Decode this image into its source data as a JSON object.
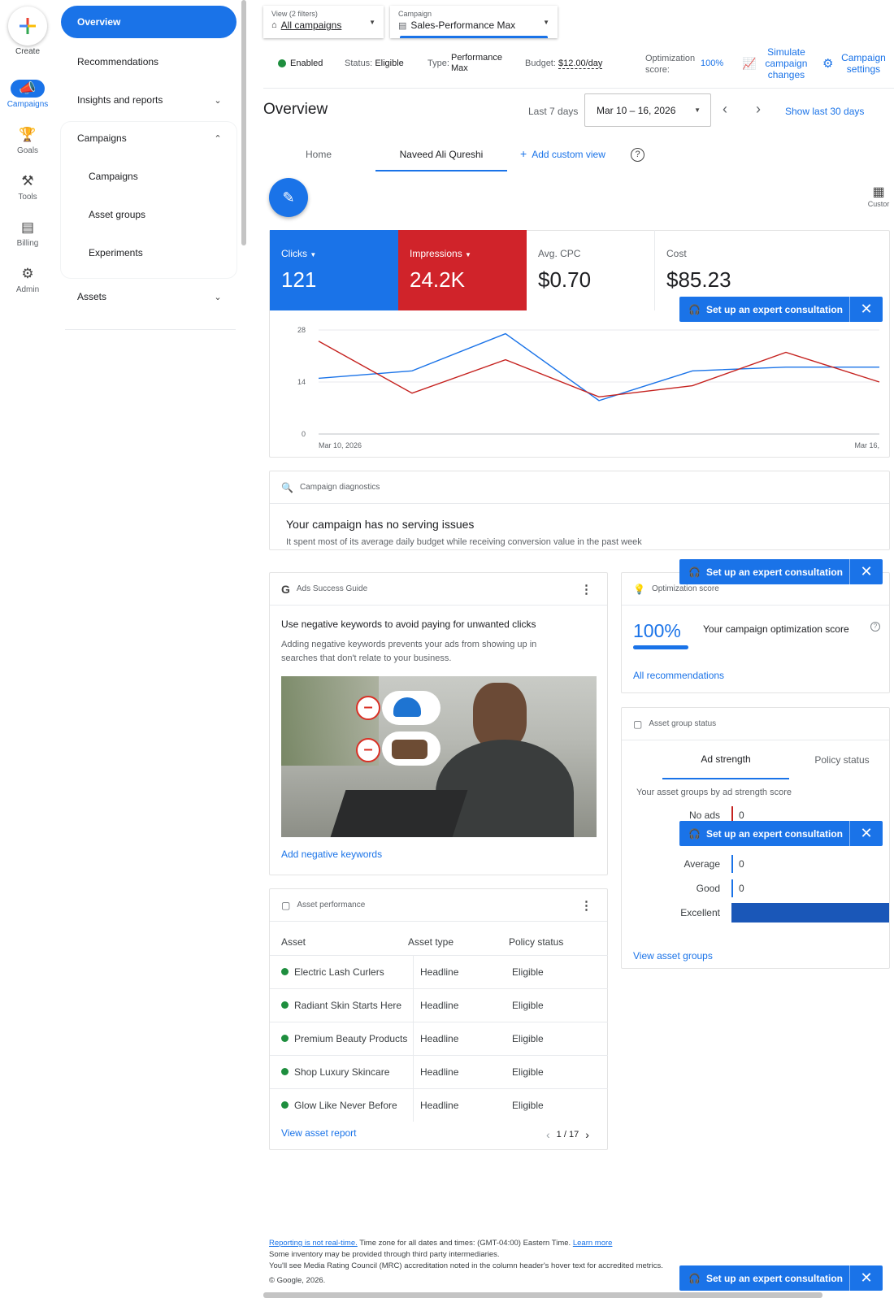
{
  "rail": {
    "create": "Create",
    "campaigns": "Campaigns",
    "goals": "Goals",
    "tools": "Tools",
    "billing": "Billing",
    "admin": "Admin"
  },
  "nav": {
    "overview": "Overview",
    "recommendations": "Recommendations",
    "insights": "Insights and reports",
    "campaigns_section": "Campaigns",
    "campaigns": "Campaigns",
    "asset_groups": "Asset groups",
    "experiments": "Experiments",
    "assets": "Assets"
  },
  "filters": {
    "view_label": "View (2 filters)",
    "view_value": "All campaigns",
    "campaign_label": "Campaign",
    "campaign_value": "Sales-Performance Max"
  },
  "status_bar": {
    "enabled": "Enabled",
    "status_label": "Status:",
    "status_value": "Eligible",
    "type_label": "Type:",
    "type_value": "Performance Max",
    "budget_label": "Budget:",
    "budget_value": "$12.00/day",
    "opt_label": "Optimization score:",
    "opt_value": "100%",
    "simulate": "Simulate campaign changes",
    "settings": "Campaign settings"
  },
  "page": {
    "title": "Overview",
    "range_label": "Last 7 days",
    "date_range": "Mar 10 – 16, 2026",
    "show_last": "Show last 30 days"
  },
  "tabs": {
    "home": "Home",
    "user": "Naveed Ali Qureshi",
    "add_view": "Add custom view"
  },
  "customize": "Custor",
  "metrics": {
    "clicks_label": "Clicks",
    "clicks_value": "121",
    "impressions_label": "Impressions",
    "impressions_value": "24.2K",
    "cpc_label": "Avg. CPC",
    "cpc_value": "$0.70",
    "cost_label": "Cost",
    "cost_value": "$85.23"
  },
  "toast": {
    "label": "Set up an expert consultation"
  },
  "chart_data": {
    "type": "line",
    "x": [
      "Mar 10, 2026",
      "Mar 11",
      "Mar 12",
      "Mar 13",
      "Mar 14",
      "Mar 15",
      "Mar 16"
    ],
    "x_tick_labels": [
      "Mar 10, 2026",
      "Mar 16,"
    ],
    "y_ticks": [
      0,
      14,
      28
    ],
    "ylim": [
      0,
      28
    ],
    "series": [
      {
        "name": "Clicks",
        "color": "#1a73e8",
        "values": [
          15,
          17,
          27,
          9,
          17,
          18,
          18
        ]
      },
      {
        "name": "Impressions",
        "color": "#c5221f",
        "values": [
          25,
          11,
          20,
          10,
          13,
          22,
          14
        ]
      }
    ]
  },
  "diagnostics": {
    "header": "Campaign diagnostics",
    "title": "Your campaign has no serving issues",
    "text": "It spent most of its average daily budget while receiving conversion value in the past week"
  },
  "guide": {
    "header": "Ads Success Guide",
    "title": "Use negative keywords to avoid paying for unwanted clicks",
    "text": "Adding negative keywords prevents your ads from showing up in searches that don't relate to your business.",
    "link": "Add negative keywords"
  },
  "optimization": {
    "header": "Optimization score",
    "value": "100%",
    "label": "Your campaign optimization score",
    "link": "All recommendations",
    "fill": 1.0
  },
  "asset_group_status": {
    "header": "Asset group status",
    "tab_strength": "Ad strength",
    "tab_policy": "Policy status",
    "subtitle": "Your asset groups by ad strength score",
    "rows": [
      {
        "label": "No ads",
        "value": "0",
        "color": "#c5221f"
      },
      {
        "label": "Average",
        "value": "0",
        "color": "#1a73e8"
      },
      {
        "label": "Good",
        "value": "0",
        "color": "#1a73e8"
      },
      {
        "label": "Excellent",
        "value": "",
        "color": "#1a57b8"
      }
    ],
    "link": "View asset groups"
  },
  "asset_perf": {
    "header": "Asset performance",
    "col_asset": "Asset",
    "col_type": "Asset type",
    "col_policy": "Policy status",
    "rows": [
      {
        "asset": "Electric Lash Curlers",
        "type": "Headline",
        "policy": "Eligible"
      },
      {
        "asset": "Radiant Skin Starts Here",
        "type": "Headline",
        "policy": "Eligible"
      },
      {
        "asset": "Premium Beauty Products",
        "type": "Headline",
        "policy": "Eligible"
      },
      {
        "asset": "Shop Luxury Skincare",
        "type": "Headline",
        "policy": "Eligible"
      },
      {
        "asset": "Glow Like Never Before",
        "type": "Headline",
        "policy": "Eligible"
      }
    ],
    "link": "View asset report",
    "pagination": "1 / 17"
  },
  "footer": {
    "reporting_link": "Reporting is not real-time.",
    "timezone": "Time zone for all dates and times: (GMT-04:00) Eastern Time.",
    "learn_more": "Learn more",
    "line2": "Some inventory may be provided through third party intermediaries.",
    "line3": "You'll see Media Rating Council (MRC) accreditation noted in the column header's hover text for accredited metrics.",
    "copyright": "© Google, 2026."
  }
}
